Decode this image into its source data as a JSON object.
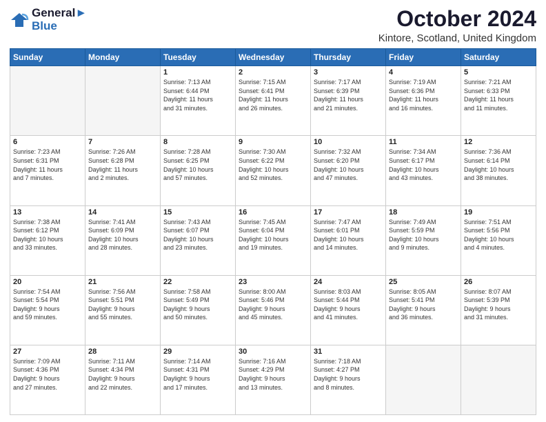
{
  "header": {
    "logo_line1": "General",
    "logo_line2": "Blue",
    "month": "October 2024",
    "location": "Kintore, Scotland, United Kingdom"
  },
  "weekdays": [
    "Sunday",
    "Monday",
    "Tuesday",
    "Wednesday",
    "Thursday",
    "Friday",
    "Saturday"
  ],
  "weeks": [
    [
      {
        "day": "",
        "detail": ""
      },
      {
        "day": "",
        "detail": ""
      },
      {
        "day": "1",
        "detail": "Sunrise: 7:13 AM\nSunset: 6:44 PM\nDaylight: 11 hours\nand 31 minutes."
      },
      {
        "day": "2",
        "detail": "Sunrise: 7:15 AM\nSunset: 6:41 PM\nDaylight: 11 hours\nand 26 minutes."
      },
      {
        "day": "3",
        "detail": "Sunrise: 7:17 AM\nSunset: 6:39 PM\nDaylight: 11 hours\nand 21 minutes."
      },
      {
        "day": "4",
        "detail": "Sunrise: 7:19 AM\nSunset: 6:36 PM\nDaylight: 11 hours\nand 16 minutes."
      },
      {
        "day": "5",
        "detail": "Sunrise: 7:21 AM\nSunset: 6:33 PM\nDaylight: 11 hours\nand 11 minutes."
      }
    ],
    [
      {
        "day": "6",
        "detail": "Sunrise: 7:23 AM\nSunset: 6:31 PM\nDaylight: 11 hours\nand 7 minutes."
      },
      {
        "day": "7",
        "detail": "Sunrise: 7:26 AM\nSunset: 6:28 PM\nDaylight: 11 hours\nand 2 minutes."
      },
      {
        "day": "8",
        "detail": "Sunrise: 7:28 AM\nSunset: 6:25 PM\nDaylight: 10 hours\nand 57 minutes."
      },
      {
        "day": "9",
        "detail": "Sunrise: 7:30 AM\nSunset: 6:22 PM\nDaylight: 10 hours\nand 52 minutes."
      },
      {
        "day": "10",
        "detail": "Sunrise: 7:32 AM\nSunset: 6:20 PM\nDaylight: 10 hours\nand 47 minutes."
      },
      {
        "day": "11",
        "detail": "Sunrise: 7:34 AM\nSunset: 6:17 PM\nDaylight: 10 hours\nand 43 minutes."
      },
      {
        "day": "12",
        "detail": "Sunrise: 7:36 AM\nSunset: 6:14 PM\nDaylight: 10 hours\nand 38 minutes."
      }
    ],
    [
      {
        "day": "13",
        "detail": "Sunrise: 7:38 AM\nSunset: 6:12 PM\nDaylight: 10 hours\nand 33 minutes."
      },
      {
        "day": "14",
        "detail": "Sunrise: 7:41 AM\nSunset: 6:09 PM\nDaylight: 10 hours\nand 28 minutes."
      },
      {
        "day": "15",
        "detail": "Sunrise: 7:43 AM\nSunset: 6:07 PM\nDaylight: 10 hours\nand 23 minutes."
      },
      {
        "day": "16",
        "detail": "Sunrise: 7:45 AM\nSunset: 6:04 PM\nDaylight: 10 hours\nand 19 minutes."
      },
      {
        "day": "17",
        "detail": "Sunrise: 7:47 AM\nSunset: 6:01 PM\nDaylight: 10 hours\nand 14 minutes."
      },
      {
        "day": "18",
        "detail": "Sunrise: 7:49 AM\nSunset: 5:59 PM\nDaylight: 10 hours\nand 9 minutes."
      },
      {
        "day": "19",
        "detail": "Sunrise: 7:51 AM\nSunset: 5:56 PM\nDaylight: 10 hours\nand 4 minutes."
      }
    ],
    [
      {
        "day": "20",
        "detail": "Sunrise: 7:54 AM\nSunset: 5:54 PM\nDaylight: 9 hours\nand 59 minutes."
      },
      {
        "day": "21",
        "detail": "Sunrise: 7:56 AM\nSunset: 5:51 PM\nDaylight: 9 hours\nand 55 minutes."
      },
      {
        "day": "22",
        "detail": "Sunrise: 7:58 AM\nSunset: 5:49 PM\nDaylight: 9 hours\nand 50 minutes."
      },
      {
        "day": "23",
        "detail": "Sunrise: 8:00 AM\nSunset: 5:46 PM\nDaylight: 9 hours\nand 45 minutes."
      },
      {
        "day": "24",
        "detail": "Sunrise: 8:03 AM\nSunset: 5:44 PM\nDaylight: 9 hours\nand 41 minutes."
      },
      {
        "day": "25",
        "detail": "Sunrise: 8:05 AM\nSunset: 5:41 PM\nDaylight: 9 hours\nand 36 minutes."
      },
      {
        "day": "26",
        "detail": "Sunrise: 8:07 AM\nSunset: 5:39 PM\nDaylight: 9 hours\nand 31 minutes."
      }
    ],
    [
      {
        "day": "27",
        "detail": "Sunrise: 7:09 AM\nSunset: 4:36 PM\nDaylight: 9 hours\nand 27 minutes."
      },
      {
        "day": "28",
        "detail": "Sunrise: 7:11 AM\nSunset: 4:34 PM\nDaylight: 9 hours\nand 22 minutes."
      },
      {
        "day": "29",
        "detail": "Sunrise: 7:14 AM\nSunset: 4:31 PM\nDaylight: 9 hours\nand 17 minutes."
      },
      {
        "day": "30",
        "detail": "Sunrise: 7:16 AM\nSunset: 4:29 PM\nDaylight: 9 hours\nand 13 minutes."
      },
      {
        "day": "31",
        "detail": "Sunrise: 7:18 AM\nSunset: 4:27 PM\nDaylight: 9 hours\nand 8 minutes."
      },
      {
        "day": "",
        "detail": ""
      },
      {
        "day": "",
        "detail": ""
      }
    ]
  ]
}
